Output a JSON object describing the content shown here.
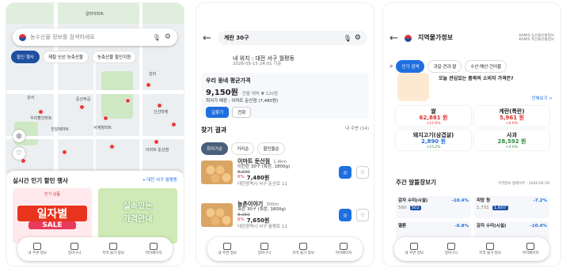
{
  "screen1": {
    "search_placeholder": "농수산물 정보를 검색하세요",
    "chips": [
      "할인 행사",
      "제철 신선 농축산물",
      "농축산물 할인지원"
    ],
    "map_labels": [
      "강서",
      "우리할인마트",
      "진달래마트",
      "서계청마트",
      "이마트 둔산점",
      "신선마켓",
      "둔산주공",
      "갈마아파트",
      "감리"
    ],
    "sheet_title": "실시간 인기 할인 행사",
    "location": "대전 서구 월평동",
    "poster1": {
      "top": "인기 상품",
      "main": "일자별",
      "sale": "SALE"
    },
    "poster2": {
      "main": "실속있는",
      "sub": "가격안내"
    },
    "tabs": [
      "내 주변 정보",
      "장바구니",
      "지역 물가 정보",
      "마이페이지"
    ]
  },
  "screen2": {
    "search_value": "계란 30구",
    "location_label": "내 위치 : 대전 서구 월평동",
    "location_date": "2026-05-15 24:01 기준",
    "avg_title": "우리 동네 평균가격",
    "avg_price": "9,150원",
    "avg_change": "전월 대비 ▼ 120원",
    "lowest": "최저가 매장 : 이마트 둔산점 (7,480원)",
    "btn_route": "길찾기",
    "btn_call": "전화",
    "results_title": "찾기 결과",
    "results_sub": "내 주변 (14)",
    "filters": [
      "최저가순",
      "거리순",
      "할인율순"
    ],
    "items": [
      {
        "store": "이마트 둔산점",
        "dist": "1.4km",
        "desc": "이천란 30구 (특란, 1800g)",
        "old": "8,000",
        "disc": "6%",
        "price": "7,480원",
        "addr": "대전광역시 서구 둔산로 11"
      },
      {
        "store": "농촌이야기",
        "dist": "300m",
        "desc": "특란 30구 (특란, 1800g)",
        "old": "8,150",
        "disc": "6%",
        "price": "7,650원",
        "addr": "대전광역시 서구 월평로 11"
      }
    ],
    "action_route": "길찾기",
    "action_save": "찜기",
    "tabs": [
      "내 주변 정보",
      "장바구니",
      "지역 물가 정보",
      "마이페이지"
    ]
  },
  "screen3": {
    "title": "지역물가정보",
    "source1": "KAMIS 농산물유통정보",
    "source2": "KAMIS 축산물유통정보",
    "chips": [
      "인기 검색",
      "과일·견과·쌀",
      "수산·해산·건어물"
    ],
    "question": "오늘 관심있는 품목의 소비자 가격은?",
    "more": "전체보기 >",
    "items": [
      {
        "name": "쌀",
        "price": "62,881 원",
        "chg": "+12.6%"
      },
      {
        "name": "계란(특란)",
        "price": "5,961 원",
        "chg": "+4.6%"
      },
      {
        "name": "돼지고기(삼겹살)",
        "price": "2,890 원",
        "chg": "+15.2%"
      },
      {
        "name": "사과",
        "price": "28,592 원",
        "chg": "+4.6%"
      }
    ],
    "weekly_title": "주간 알뜰장보기",
    "weekly_sub": "가격정보 업데이트 : 2026-05-29",
    "weekly": [
      {
        "name": "감자 수미(시설)",
        "chg": "-10.4%",
        "a": "560",
        "b": "502"
      },
      {
        "name": "피망 청",
        "chg": "-7.2%",
        "a": "1,731",
        "b": "1,607"
      },
      {
        "name": "멜론",
        "chg": "-6.8%"
      },
      {
        "name": "감자 수미(시설)",
        "chg": "-10.4%"
      }
    ],
    "tabs": [
      "내 주변 정보",
      "장바구니",
      "지역 물가 정보",
      "마이페이지"
    ]
  }
}
